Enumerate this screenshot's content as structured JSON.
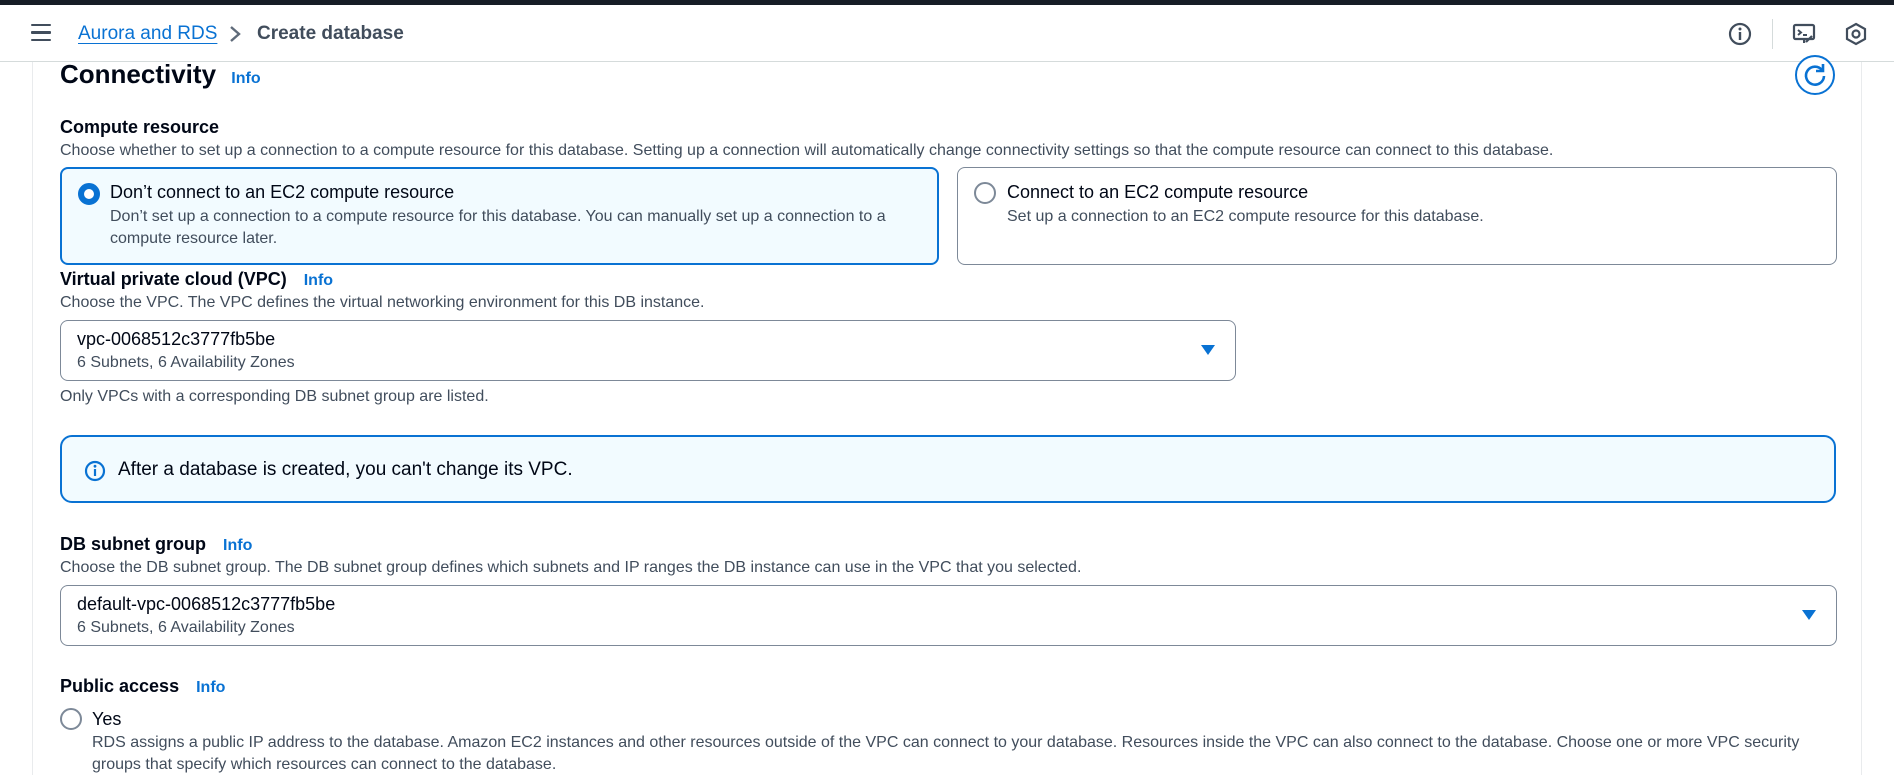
{
  "header": {
    "breadcrumb_parent": "Aurora and RDS",
    "breadcrumb_current": "Create database",
    "icons": [
      "menu-icon",
      "info-circle-icon",
      "cloudshell-icon",
      "settings-hex-icon"
    ]
  },
  "connectivity": {
    "title": "Connectivity",
    "info_label": "Info"
  },
  "compute": {
    "label": "Compute resource",
    "description": "Choose whether to set up a connection to a compute resource for this database. Setting up a connection will automatically change connectivity settings so that the compute resource can connect to this database.",
    "options": [
      {
        "title": "Don’t connect to an EC2 compute resource",
        "desc_line1": "Don’t set up a connection to a compute resource for this database. You can manually set up a connection to a",
        "desc_line2": "compute resource later.",
        "selected": true
      },
      {
        "title": "Connect to an EC2 compute resource",
        "desc_line1": "Set up a connection to an EC2 compute resource for this database.",
        "selected": false
      }
    ]
  },
  "vpc": {
    "label": "Virtual private cloud (VPC)",
    "info_label": "Info",
    "description": "Choose the VPC. The VPC defines the virtual networking environment for this DB instance.",
    "selected_value": "vpc-0068512c3777fb5be",
    "selected_sub": "6 Subnets, 6 Availability Zones",
    "hint": "Only VPCs with a corresponding DB subnet group are listed.",
    "alert": "After a database is created, you can't change its VPC."
  },
  "subnet": {
    "label": "DB subnet group",
    "info_label": "Info",
    "description": "Choose the DB subnet group. The DB subnet group defines which subnets and IP ranges the DB instance can use in the VPC that you selected.",
    "selected_value": "default-vpc-0068512c3777fb5be",
    "selected_sub": "6 Subnets, 6 Availability Zones"
  },
  "public_access": {
    "label": "Public access",
    "info_label": "Info",
    "yes_label": "Yes",
    "yes_desc_line1": "RDS assigns a public IP address to the database. Amazon EC2 instances and other resources outside of the VPC can connect to your database. Resources inside the VPC can also connect to the database. Choose one or more VPC security",
    "yes_desc_line2": "groups that specify which resources can connect to the database."
  },
  "colors": {
    "accent": "#0972d3",
    "selected_bg": "#f2fbff",
    "text": "#000716",
    "muted": "#414d5c"
  }
}
